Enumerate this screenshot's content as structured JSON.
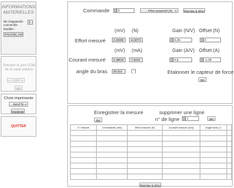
{
  "sidebar": {
    "title_line1": "INFORMATIONS",
    "title_line2": "MATERIELLES",
    "nb_devices_label": "Nb d'appareils",
    "connected_label": "connectés",
    "nb_devices_value": "0",
    "model_label": "Modèle :",
    "model_value": "FALCON_ALPHA",
    "com_hint": "Préciser le port COM de la carte arduino",
    "com_select": "COM7",
    "com_ok": "OK",
    "printer_label": "Choix imprimante",
    "printer_select": "Send To",
    "print_button": "Imprimer",
    "quit_button": "QUITTER"
  },
  "top": {
    "commande_label": "Commande",
    "commande_value": "2",
    "effort_select": "Effort progressif (N)",
    "reset_button": "Remise à Zéro",
    "unit_mv": "(mV)",
    "unit_n": "(N)",
    "unit_ma": "(mA)",
    "gain_n_label": "Gain (N/V)",
    "offset_n_label": "Offset (N)",
    "gain_a_label": "Gain (A/V)",
    "offset_a_label": "Offset (A)",
    "effort_label": "Effort mesuré",
    "effort_mv": "2,33388",
    "effort_n": "14,5074",
    "gain_n_value": "6,25",
    "offset_n_value": "0",
    "courant_label": "Courant mesuré",
    "courant_mv": "2,48533",
    "courant_ma": "-7,5242",
    "gain_a_value": "0,5",
    "offset_a_value": "-1,25",
    "angle_label": "angle du bras",
    "angle_value": "30,412",
    "angle_unit": "(°)",
    "calib_label": "Etalonner le capteur de force",
    "calib_ok": "OK"
  },
  "bottom": {
    "save_label": "Enregistrer la mesure",
    "save_ok": "OK",
    "delete_label": "supprimer une ligne",
    "line_label": "n° de ligne",
    "line_value": "1",
    "delete_ok": "OK",
    "columns": [
      "n° mesure",
      "Commande (mA)",
      "Effort mesuré (N)",
      "Courant mesuré (mA)",
      "Angle bras (°)"
    ],
    "reset_button": "Remise à Zéro"
  },
  "colors": {
    "quit_text": "#e0342b",
    "title_text": "#7a7a7a"
  }
}
